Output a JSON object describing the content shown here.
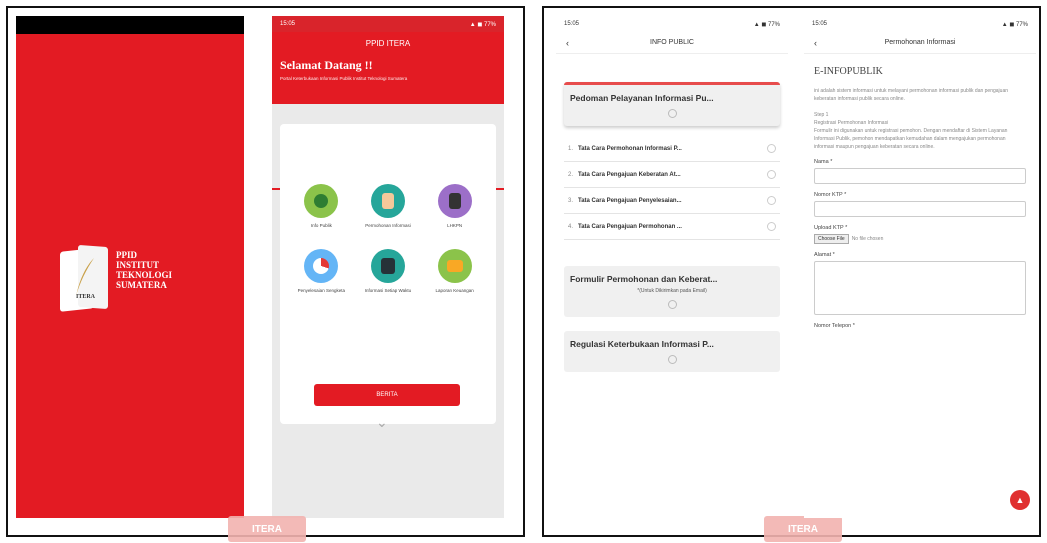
{
  "splash": {
    "logo_line1": "PPID",
    "logo_line2": "INSTITUT",
    "logo_line3": "TEKNOLOGI",
    "logo_line4": "SUMATERA",
    "logo_small": "ITERA"
  },
  "home": {
    "status_time": "15:05",
    "status_right": "▲ ◼ 77%",
    "title": "PPID ITERA",
    "welcome": "Selamat Datang !!",
    "subtitle": "Portal Keterbukaan Informasi Publik Institut Teknologi Sumatera",
    "menu": [
      {
        "label": "Info Publik",
        "icon": "globe-icon",
        "color": "#8bc34a"
      },
      {
        "label": "Permohonan Informasi",
        "icon": "hand-icon",
        "color": "#26a69a"
      },
      {
        "label": "LHKPN",
        "icon": "book-icon",
        "color": "#9c6fc8"
      },
      {
        "label": "Penyelesaian Sengketa",
        "icon": "pie-chart-icon",
        "color": "#64b5f6"
      },
      {
        "label": "Informasi Setiap Waktu",
        "icon": "card-icon",
        "color": "#26a69a"
      },
      {
        "label": "Laporan Keuangan",
        "icon": "wallet-icon",
        "color": "#8bc34a"
      }
    ],
    "button": "BERITA"
  },
  "watermark": "ITERA",
  "info": {
    "status_time": "15:05",
    "status_right": "▲ ◼ 77%",
    "title": "INFO PUBLIC",
    "section1_title": "Pedoman Pelayanan Informasi Pu...",
    "items": [
      {
        "num": "1.",
        "text": "Tata Cara Permohonan Informasi P..."
      },
      {
        "num": "2.",
        "text": "Tata Cara Pengajuan Keberatan At..."
      },
      {
        "num": "3.",
        "text": "Tata Cara Pengajuan Penyelesaian..."
      },
      {
        "num": "4.",
        "text": "Tata Cara Pengajuan Permohonan ..."
      }
    ],
    "section2_title": "Formulir Permohonan dan Keberat...",
    "section2_desc": "*(Untuk Dikirimkan pada Email)",
    "section3_title": "Regulasi Keterbukaan Informasi P..."
  },
  "permo": {
    "status_time": "15:05",
    "status_right": "▲ ◼ 77%",
    "title": "Permohonan Informasi",
    "heading": "E-INFOPUBLIK",
    "intro": "ini adalah sistem informasi untuk melayani permohonan informasi publik dan pengajuan keberatan informasi publik secara online.",
    "step_title": "Step 1",
    "step_sub": "Registrasi Permohonan Informasi",
    "step_body": "Formulir ini digunakan untuk registrasi pemohon. Dengan mendaftar di Sistem Layanan Informasi Publik, pemohon mendapatkan kemudahan dalam mengajukan permohonan informasi maupun pengajuan keberatan secara online.",
    "label_name": "Nama *",
    "label_ktp": "Nomor KTP *",
    "label_upload": "Upload KTP *",
    "file_button": "Choose File",
    "file_status": "No file chosen",
    "label_alamat": "Alamat *",
    "label_phone": "Nomor Telepon *",
    "fab": "▲"
  }
}
